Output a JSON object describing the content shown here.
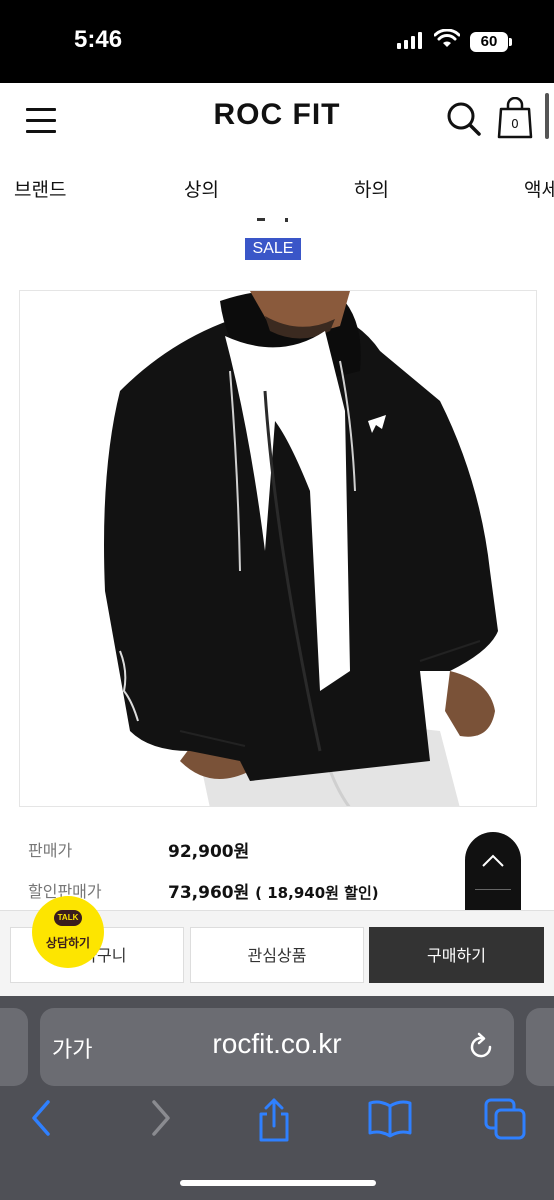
{
  "status": {
    "time": "5:46",
    "battery": "60"
  },
  "header": {
    "logo": "ROC FIT",
    "cart_count": "0"
  },
  "categories": [
    "브랜드",
    "상의",
    "하의",
    "액세"
  ],
  "product": {
    "sale_badge": "SALE"
  },
  "price": {
    "list_label": "판매가",
    "list_value": "92,900원",
    "discount_label": "할인판매가",
    "discount_value": "73,960원",
    "discount_extra": "( 18,940원 할인)"
  },
  "actions": {
    "cart": "장바구니",
    "wish": "관심상품",
    "buy": "구매하기"
  },
  "kakao": {
    "talk": "TALK",
    "label": "상담하기"
  },
  "browser": {
    "aa": "가가",
    "url": "rocfit.co.kr"
  },
  "colors": {
    "sale": "#3a56c8",
    "kakao": "#fde500",
    "browser_bg": "#4f5056",
    "buy_button": "#333333",
    "ios_blue": "#2f80ff"
  }
}
